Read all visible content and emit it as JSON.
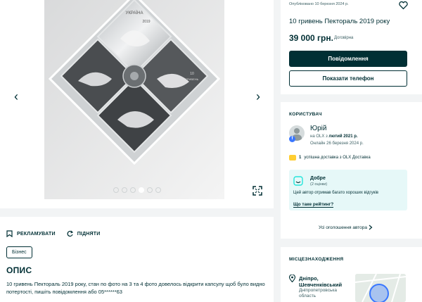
{
  "gallery": {
    "prev_label": "‹",
    "next_label": "›",
    "slide_count": 6,
    "active_slide": 4
  },
  "ad": {
    "posted": "Опубліковано 10 березня 2024 р.",
    "title": "10 гривень Пектораль 2019 року",
    "price": "39 000 грн.",
    "negotiable": "Договірна",
    "message_button": "Повідомлення",
    "phone_button": "Показати телефон"
  },
  "actions": {
    "promote": "РЕКЛАМУВАТИ",
    "raise": "ПІДНЯТИ"
  },
  "badge": "Бізнес",
  "description": {
    "heading": "ОПИС",
    "text": "10 гривень Пектораль 2019 року, стан по фото на 3 та 4 фото довелось відкрити капсулу щоб було видно потертості, пишіть повідомлення або 05******63"
  },
  "user": {
    "heading": "КОРИСТУВАЧ",
    "name": "Юрій",
    "since_prefix": "на OLX з",
    "since_date": "лютий 2021 р.",
    "online": "Онлайн 26 березня 2024 р.",
    "delivery_count": "1",
    "delivery_text": "успішна доставка з OLX Доставка"
  },
  "rating": {
    "label": "Добре",
    "count": "(2 оцінки)",
    "description": "Цей автор отримав багато хороших відгуків",
    "link": "Що таке рейтинг?"
  },
  "all_ads": "Усі оголошення автора",
  "location": {
    "heading": "МІСЦЕЗНАХОДЖЕННЯ",
    "city": "Дніпро,",
    "district": "Шевченківський",
    "region_line1": "Дніпропетровська",
    "region_line2": "область"
  },
  "coin_text": {
    "country": "УКРАЇНА",
    "year": "2019",
    "denomination": "10",
    "currency": "ГРИВЕНЬ"
  },
  "colors": {
    "brand": "#002f34",
    "accent_map": "#3a77ff",
    "rating_bg": "#e6f8f8"
  }
}
